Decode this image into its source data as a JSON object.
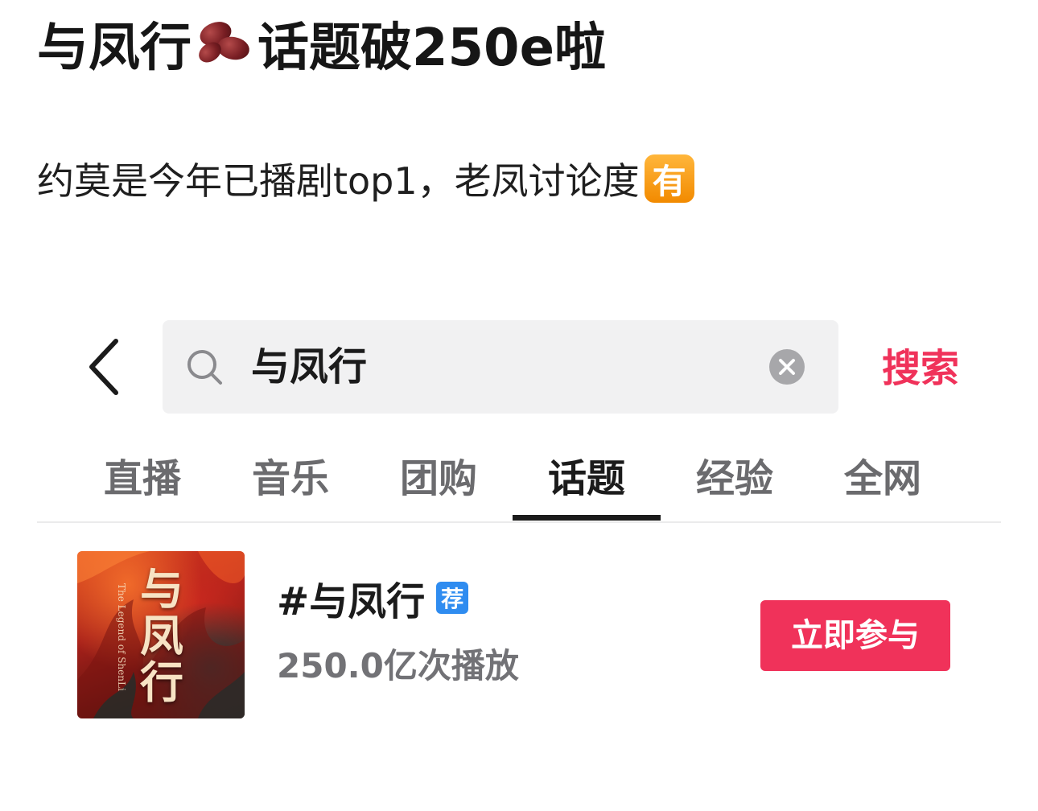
{
  "post": {
    "title_before": "与凤行",
    "title_icon": "red-bean-icon",
    "title_after": "话题破250e啦",
    "body_text": "约莫是今年已播剧top1，老凤讨论度",
    "body_emoji": "有"
  },
  "search": {
    "query": "与凤行",
    "button_label": "搜索",
    "accent_color": "#f0325a"
  },
  "tabs": [
    {
      "label": "直播",
      "active": false
    },
    {
      "label": "音乐",
      "active": false
    },
    {
      "label": "团购",
      "active": false
    },
    {
      "label": "话题",
      "active": true
    },
    {
      "label": "经验",
      "active": false
    },
    {
      "label": "全网",
      "active": false
    }
  ],
  "result": {
    "cover_title": "与凤行",
    "cover_subtitle": "The Legend of ShenLi",
    "topic_title": "#与凤行",
    "badge": "荐",
    "play_count": "250.0亿次播放",
    "join_label": "立即参与"
  }
}
